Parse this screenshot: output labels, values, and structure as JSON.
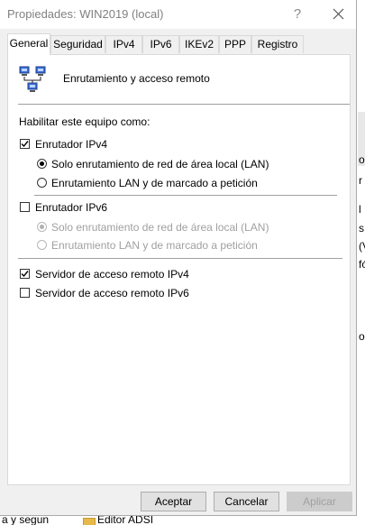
{
  "dialog": {
    "title": "Propiedades: WIN2019 (local)",
    "help_label": "?",
    "tabs": [
      "General",
      "Seguridad",
      "IPv4",
      "IPv6",
      "IKEv2",
      "PPP",
      "Registro"
    ],
    "active_tab": "General"
  },
  "general": {
    "header": "Enrutamiento y acceso remoto",
    "enable_label": "Habilitar este equipo como:",
    "ipv4_router": {
      "label": "Enrutador IPv4",
      "checked": true,
      "options": [
        {
          "label": "Solo enrutamiento de red de área local (LAN)",
          "selected": true
        },
        {
          "label": "Enrutamiento LAN y de marcado a petición",
          "selected": false
        }
      ]
    },
    "ipv6_router": {
      "label": "Enrutador IPv6",
      "checked": false,
      "options": [
        {
          "label": "Solo enrutamiento de red de área local (LAN)",
          "selected": true
        },
        {
          "label": "Enrutamiento LAN y de marcado a petición",
          "selected": false
        }
      ]
    },
    "ipv4_ras": {
      "label": "Servidor de acceso remoto IPv4",
      "checked": true
    },
    "ipv6_ras": {
      "label": "Servidor de acceso remoto IPv6",
      "checked": false
    }
  },
  "buttons": {
    "accept": "Aceptar",
    "cancel": "Cancelar",
    "apply": "Aplicar"
  },
  "background": {
    "right_fragments": [
      "o",
      "r",
      "l",
      "s",
      "(V",
      "fó",
      "o"
    ],
    "bottom_left": "a y segun",
    "bottom_item": "Editor ADSI"
  },
  "icons": {
    "close": "close-icon",
    "routing": "network-routing-icon"
  }
}
